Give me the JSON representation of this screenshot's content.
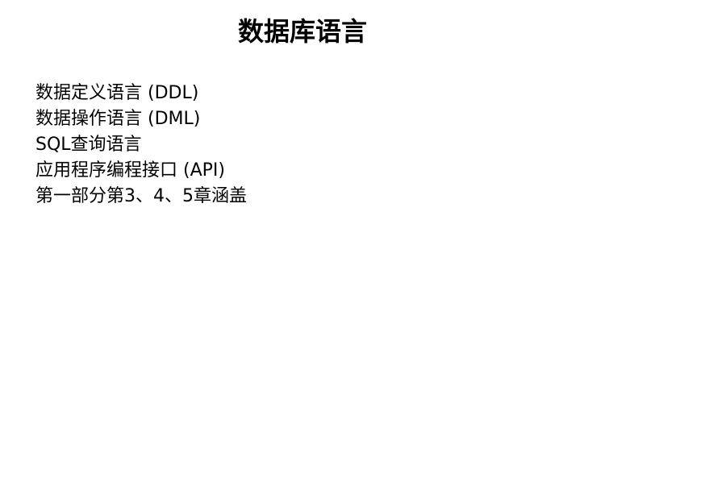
{
  "slide": {
    "title": "数据库语言",
    "items": [
      "数据定义语言 (DDL)",
      "数据操作语言 (DML)",
      "SQL查询语言",
      "应用程序编程接口 (API)",
      "第一部分第3、4、5章涵盖"
    ]
  }
}
